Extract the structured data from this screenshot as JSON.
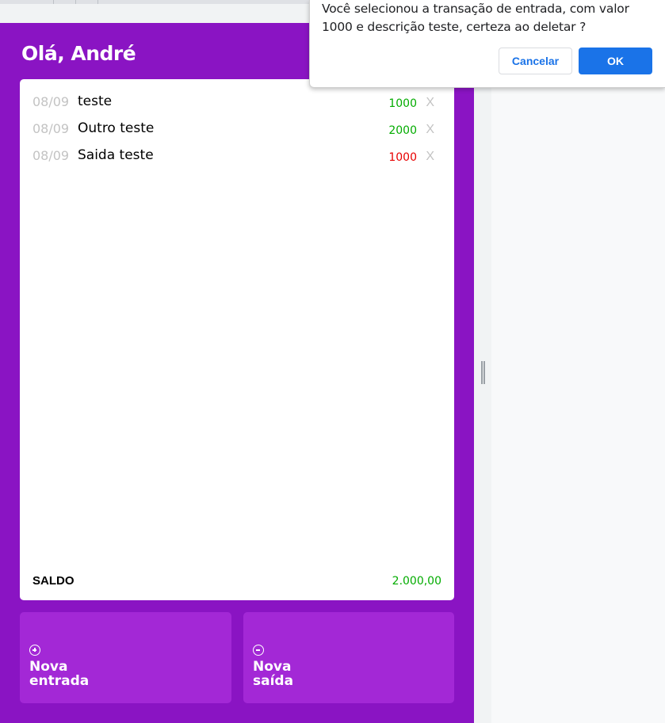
{
  "app": {
    "greeting": "Olá, André"
  },
  "transactions": [
    {
      "date": "08/09",
      "description": "teste",
      "value": "1000",
      "type": "entrada",
      "delete_label": "X"
    },
    {
      "date": "08/09",
      "description": "Outro teste",
      "value": "2000",
      "type": "entrada",
      "delete_label": "X"
    },
    {
      "date": "08/09",
      "description": "Saida teste",
      "value": "1000",
      "type": "saida",
      "delete_label": "X"
    }
  ],
  "balance": {
    "label": "SALDO",
    "value": "2.000,00"
  },
  "actions": {
    "new_income": {
      "line1": "Nova",
      "line2": "entrada",
      "icon": "plus-circle-icon"
    },
    "new_expense": {
      "line1": "Nova",
      "line2": "saída",
      "icon": "minus-circle-icon"
    }
  },
  "dialog": {
    "message": "Você selecionou a transação de entrada, com valor 1000 e descrição teste, certeza ao deletar ?",
    "cancel_label": "Cancelar",
    "ok_label": "OK"
  },
  "colors": {
    "app_background": "#8a14c3",
    "action_button": "#a328d6",
    "income": "#03ac00",
    "expense": "#e80000",
    "dialog_ok": "#1a73e8"
  }
}
